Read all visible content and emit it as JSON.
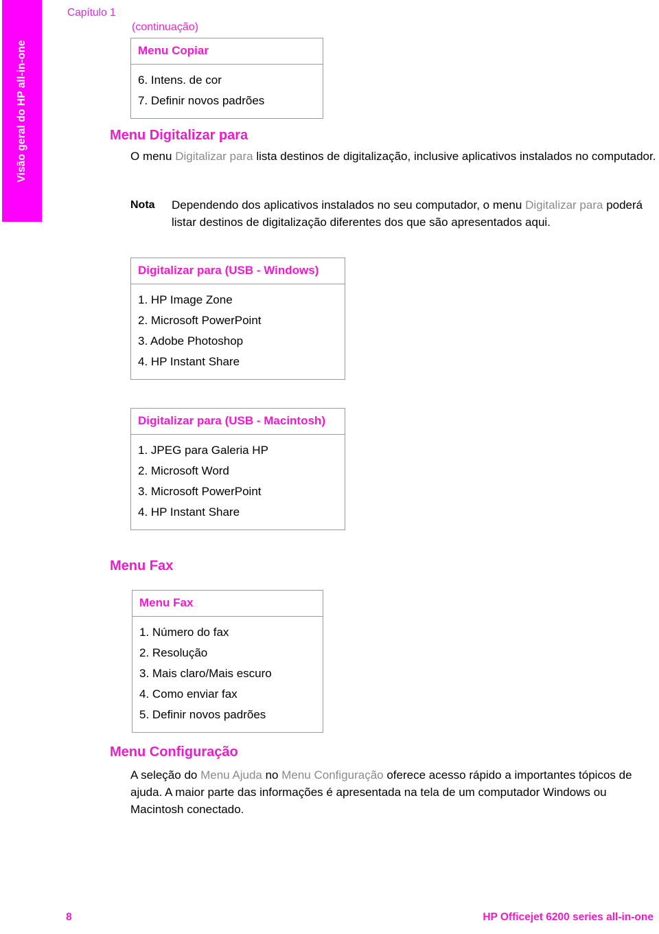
{
  "side_tab": {
    "label": "Visão geral do HP all-in-one",
    "background": "#ff00ff",
    "text_color": "#ffffff"
  },
  "header": {
    "chapter": "Capítulo 1",
    "continuation": "(continuação)"
  },
  "colors": {
    "magenta": "#ee1ccc",
    "chapter_magenta": "#cc33cc",
    "inline_emphasis_gray": "#8a8a8a",
    "table_border": "#9a9a9a"
  },
  "tables": [
    {
      "id": "table-copiar",
      "title": "Menu Copiar",
      "rows": [
        "6. Intens. de cor",
        "7. Definir novos padrões"
      ]
    },
    {
      "id": "table-usb-win",
      "title": "Digitalizar para (USB - Windows)",
      "rows": [
        "1. HP Image Zone",
        "2. Microsoft PowerPoint",
        "3. Adobe Photoshop",
        "4. HP Instant Share"
      ]
    },
    {
      "id": "table-usb-mac",
      "title": "Digitalizar para (USB - Macintosh)",
      "rows": [
        "1. JPEG para Galeria HP",
        "2. Microsoft Word",
        "3. Microsoft PowerPoint",
        "4. HP Instant Share"
      ]
    },
    {
      "id": "table-fax",
      "title": "Menu Fax",
      "rows": [
        "1. Número do fax",
        "2. Resolução",
        "3. Mais claro/Mais escuro",
        "4. Como enviar fax",
        "5. Definir novos padrões"
      ]
    }
  ],
  "sections": {
    "digitalizar": {
      "heading": "Menu Digitalizar para",
      "paragraph": {
        "before": "O menu ",
        "emphasis": "Digitalizar para",
        "after": " lista destinos de digitalização, inclusive aplicativos instalados no computador."
      },
      "note": {
        "label": "Nota",
        "before": "Dependendo dos aplicativos instalados no seu computador, o menu ",
        "emphasis": "Digitalizar para",
        "after": " poderá listar destinos de digitalização diferentes dos que são apresentados aqui."
      }
    },
    "fax": {
      "heading": "Menu Fax"
    },
    "configuracao": {
      "heading": "Menu Configuração",
      "paragraph": {
        "p1": "A seleção do ",
        "emphasis1": "Menu Ajuda",
        "p2": " no ",
        "emphasis2": "Menu Configuração",
        "p3": " oferece acesso rápido a importantes tópicos de ajuda. A maior parte das informações é apresentada na tela de um computador Windows ou Macintosh conectado."
      }
    }
  },
  "footer": {
    "page_number": "8",
    "product": "HP Officejet 6200 series all-in-one"
  }
}
